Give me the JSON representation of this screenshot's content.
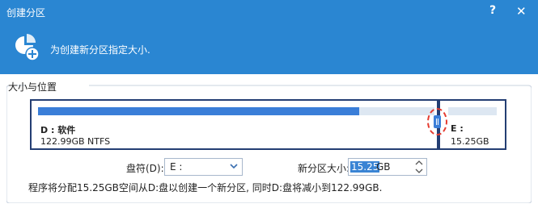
{
  "window": {
    "title": "创建分区",
    "help_label": "?",
    "close_label": "✕"
  },
  "header": {
    "text": "为创建新分区指定大小.",
    "icon": "partition-add-icon"
  },
  "group": {
    "label": "大小与位置"
  },
  "partitions": [
    {
      "name": "D : 软件",
      "info": "122.99GB NTFS",
      "used_fraction": 0.81
    },
    {
      "name": "E :",
      "info": "15.25GB"
    }
  ],
  "controls": {
    "drive_label": "盘符(D):",
    "drive_value": "E :",
    "size_label": "新分区大小:",
    "size_value": "15.25",
    "size_unit": "GB"
  },
  "summary": "程序将分配15.25GB空间从D:盘以创建一个新分区, 同时D:盘将减小到122.99GB.",
  "colors": {
    "header_bg": "#2a86d2",
    "partition_border": "#243e73",
    "bar_fill": "#3a7ed8",
    "bar_empty": "#dde7f2",
    "handle_ring": "#e53b2f"
  }
}
